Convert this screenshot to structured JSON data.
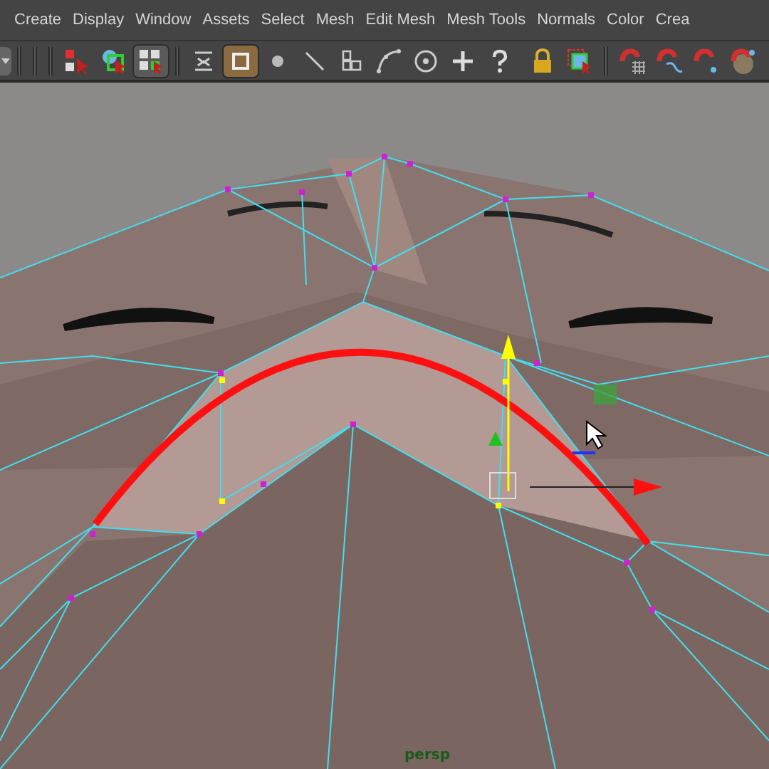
{
  "menu_bar": {
    "items": [
      "Create",
      "Display",
      "Window",
      "Assets",
      "Select",
      "Mesh",
      "Edit Mesh",
      "Mesh Tools",
      "Normals",
      "Color",
      "Crea"
    ]
  },
  "toolbar": {
    "tools": [
      {
        "selected": false
      },
      {
        "selected": false
      },
      {
        "selected": true
      },
      {
        "selected": false
      },
      {
        "selected": true
      },
      {
        "selected": false
      },
      {
        "selected": false
      },
      {
        "selected": false
      },
      {
        "selected": false
      },
      {
        "selected": false
      },
      {
        "selected": false
      },
      {
        "selected": false
      },
      {
        "selected": false
      },
      {
        "selected": false
      },
      {
        "selected": false
      },
      {
        "selected": false
      },
      {
        "selected": false
      },
      {
        "selected": false
      }
    ]
  },
  "viewport": {
    "camera_label": "persp"
  }
}
